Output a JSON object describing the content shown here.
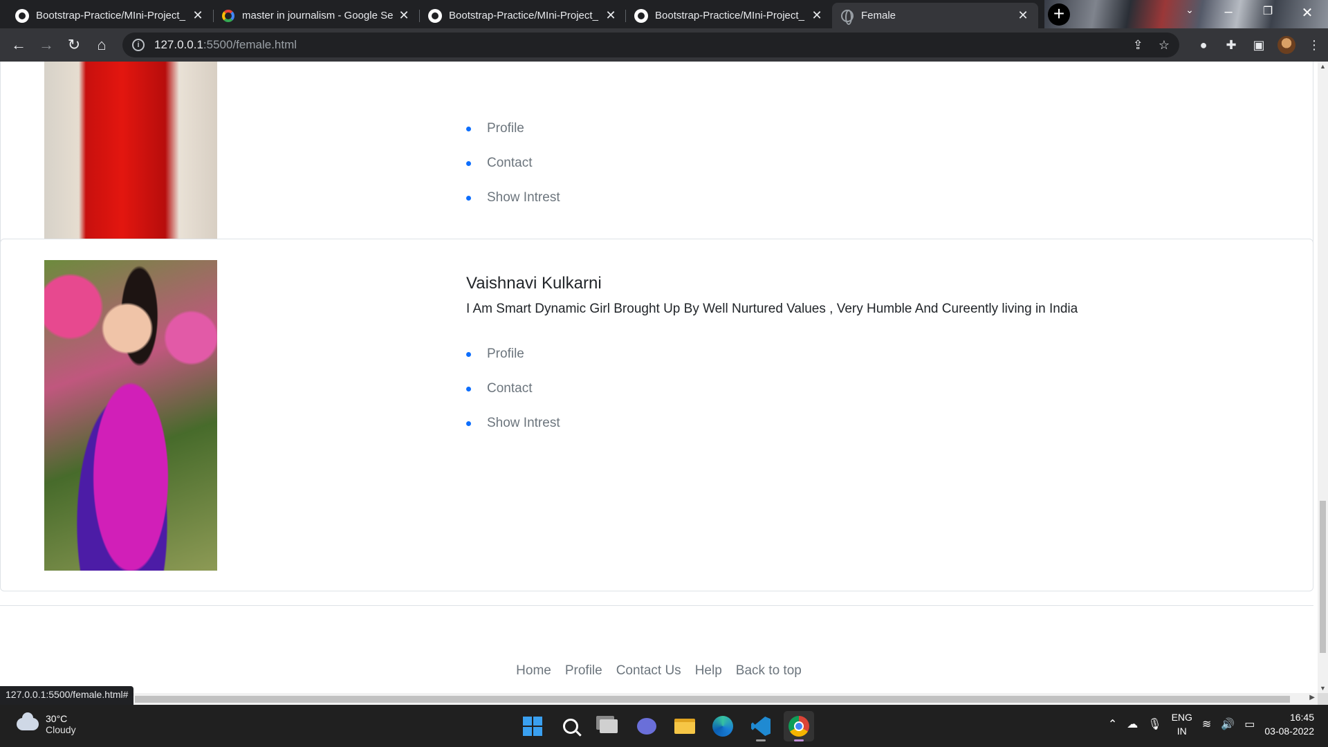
{
  "browser": {
    "tabs": [
      {
        "title": "Bootstrap-Practice/MIni-Project_",
        "icon": "github-icon",
        "active": false
      },
      {
        "title": "master in journalism - Google Se",
        "icon": "google-icon",
        "active": false
      },
      {
        "title": "Bootstrap-Practice/MIni-Project_",
        "icon": "github-icon",
        "active": false
      },
      {
        "title": "Bootstrap-Practice/MIni-Project_",
        "icon": "github-icon",
        "active": false
      },
      {
        "title": "Female",
        "icon": "globe-icon",
        "active": true
      }
    ],
    "url_host": "127.0.0.1",
    "url_path": ":5500/female.html",
    "status_url": "127.0.0.1:5500/female.html#"
  },
  "page": {
    "card1": {
      "links": [
        "Profile",
        "Contact",
        "Show Intrest"
      ]
    },
    "card2": {
      "name": "Vaishnavi Kulkarni",
      "description": "I Am Smart Dynamic Girl Brought Up By Well Nurtured Values , Very Humble And Cureently living in India",
      "links": [
        "Profile",
        "Contact",
        "Show Intrest"
      ]
    },
    "footer_links": [
      "Home",
      "Profile",
      "Contact Us",
      "Help",
      "Back to top"
    ]
  },
  "taskbar": {
    "temperature": "30°C",
    "condition": "Cloudy",
    "lang_top": "ENG",
    "lang_bottom": "IN",
    "time": "16:45",
    "date": "03-08-2022"
  },
  "colors": {
    "link_bullet": "#0d6efd",
    "link_text": "#6c757d",
    "card_border": "#dee2e6"
  }
}
